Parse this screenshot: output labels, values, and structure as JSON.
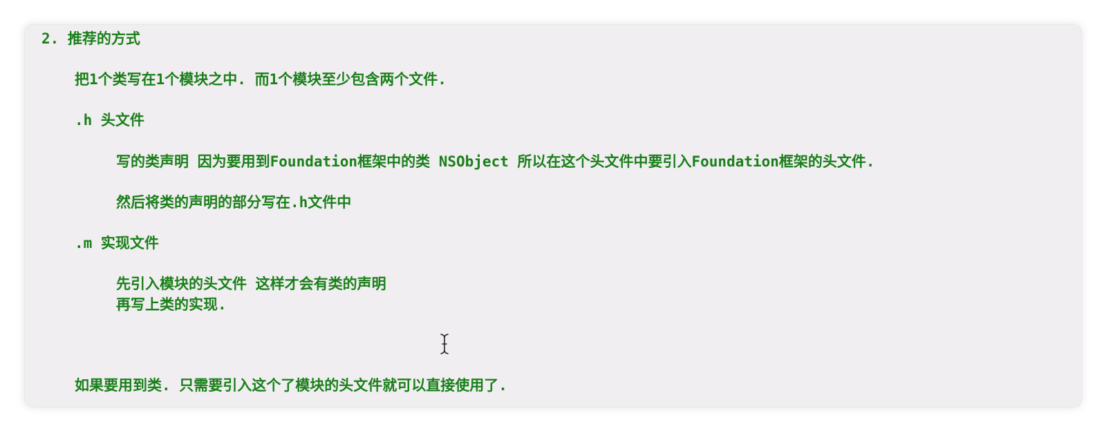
{
  "document": {
    "heading": "2. 推荐的方式",
    "intro": "把1个类写在1个模块之中. 而1个模块至少包含两个文件.",
    "h_file": {
      "title": ".h 头文件",
      "line1": "写的类声明 因为要用到Foundation框架中的类 NSObject 所以在这个头文件中要引入Foundation框架的头文件.",
      "line2": "然后将类的声明的部分写在.h文件中"
    },
    "m_file": {
      "title": ".m 实现文件",
      "line1": "先引入模块的头文件 这样才会有类的声明",
      "line2": "再写上类的实现."
    },
    "conclusion": "如果要用到类. 只需要引入这个了模块的头文件就可以直接使用了."
  },
  "colors": {
    "text": "#1a7f1a",
    "panel": "#f0eef0"
  },
  "icons": {
    "cursor": "text-cursor-icon"
  }
}
